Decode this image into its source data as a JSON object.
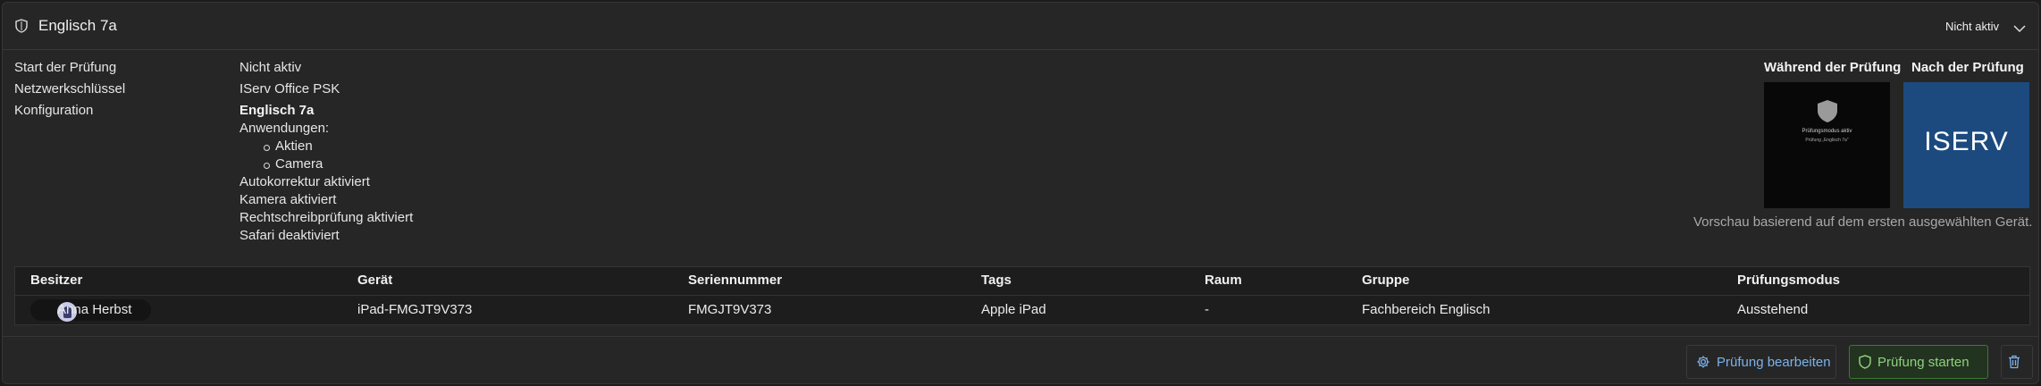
{
  "header": {
    "title": "Englisch 7a",
    "status": "Nicht aktiv"
  },
  "details": {
    "start_label": "Start der Prüfung",
    "start_value": "Nicht aktiv",
    "network_label": "Netzwerkschlüssel",
    "network_value": "IServ Office PSK",
    "config_label": "Konfiguration",
    "config_name": "Englisch 7a",
    "apps_label": "Anwendungen:",
    "apps": [
      "Aktien",
      "Camera"
    ],
    "settings": [
      "Autokorrektur aktiviert",
      "Kamera aktiviert",
      "Rechtschreibprüfung aktiviert",
      "Safari deaktiviert"
    ]
  },
  "preview": {
    "during_label": "Während der Prüfung",
    "after_label": "Nach der Prüfung",
    "during_line1": "Prüfungsmodus aktiv",
    "during_line2": "Prüfung „Englisch 7a\"",
    "logo_text": "ISERV",
    "note": "Vorschau basierend auf dem ersten ausgewählten Gerät."
  },
  "table": {
    "columns": [
      "Besitzer",
      "Gerät",
      "Seriennummer",
      "Tags",
      "Raum",
      "Gruppe",
      "Prüfungsmodus"
    ],
    "rows": [
      {
        "owner": "Anna Herbst",
        "device": "iPad-FMGJT9V373",
        "serial": "FMGJT9V373",
        "tags": "Apple iPad",
        "room": "-",
        "group": "Fachbereich Englisch",
        "mode": "Ausstehend"
      }
    ]
  },
  "actions": {
    "edit": "Prüfung bearbeiten",
    "start": "Prüfung starten"
  },
  "colors": {
    "accent_blue": "#7ab2ec",
    "accent_green": "#8ed07f",
    "preview_blue": "#1c4a7f"
  },
  "icons": [
    "shield-icon",
    "chevron-down-icon",
    "gear-icon",
    "shield-start-icon",
    "trash-icon"
  ]
}
